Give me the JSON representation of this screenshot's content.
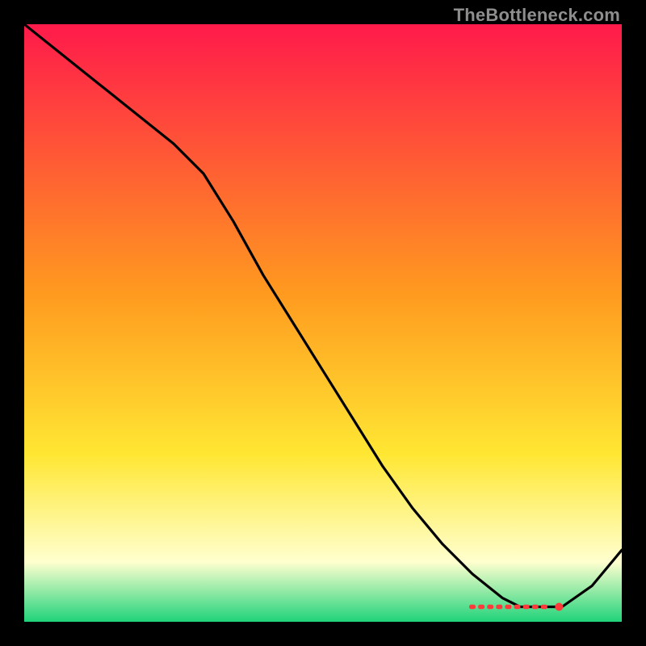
{
  "watermark": "TheBottleneck.com",
  "chart_data": {
    "type": "line",
    "title": "",
    "xlabel": "",
    "ylabel": "",
    "xlim": [
      0,
      100
    ],
    "ylim": [
      0,
      100
    ],
    "grid": false,
    "legend": false,
    "background_gradient": {
      "top": "#ff1a4b",
      "mid_upper": "#ff9a1f",
      "mid_lower": "#ffe733",
      "pale": "#ffffcf",
      "bottom": "#1fd37a"
    },
    "series": [
      {
        "name": "curve",
        "color": "#000000",
        "x": [
          0,
          5,
          10,
          15,
          20,
          25,
          30,
          35,
          40,
          45,
          50,
          55,
          60,
          65,
          70,
          75,
          80,
          83,
          86,
          90,
          95,
          100
        ],
        "y": [
          100,
          96,
          92,
          88,
          84,
          80,
          75,
          67,
          58,
          50,
          42,
          34,
          26,
          19,
          13,
          8,
          4,
          2.5,
          2.5,
          2.5,
          6,
          12
        ]
      },
      {
        "name": "marker-dash",
        "type": "marker",
        "color": "#ff3a3a",
        "x": [
          75,
          76.5,
          78,
          79.5,
          81,
          82.5,
          84,
          85.5,
          87,
          89.5
        ],
        "y": [
          2.5,
          2.5,
          2.5,
          2.5,
          2.5,
          2.5,
          2.5,
          2.5,
          2.5,
          2.5
        ]
      }
    ]
  }
}
